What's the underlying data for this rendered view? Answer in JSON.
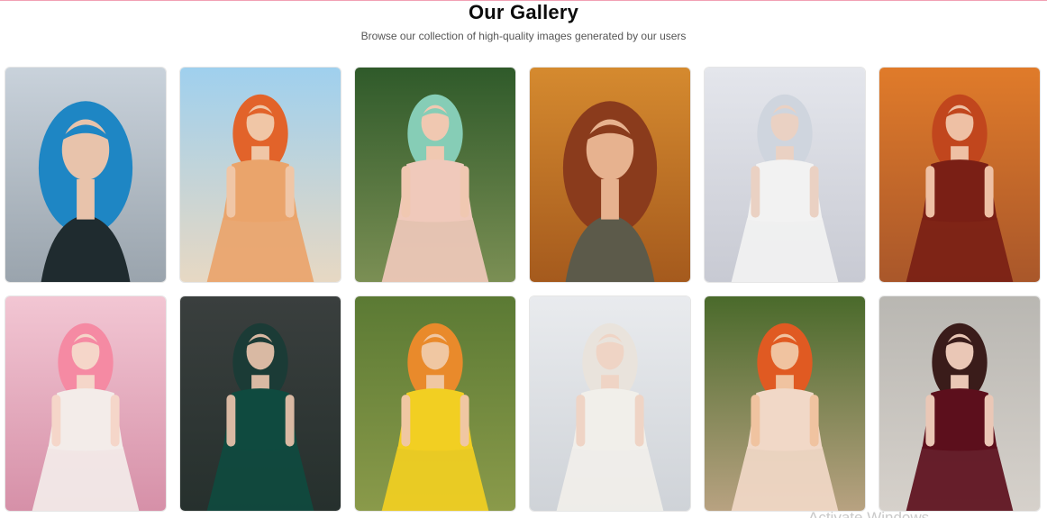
{
  "header": {
    "title": "Our Gallery",
    "subtitle": "Browse our collection of high-quality images generated by our users"
  },
  "gallery": {
    "images": [
      {
        "subject": "woman with long blue hair",
        "bg_top": "#c9d2db",
        "bg_bottom": "#9aa4ad",
        "hair": "#1e86c4",
        "skin": "#e8c3ab",
        "outfit": "#1f2b2f"
      },
      {
        "subject": "woman in floral romper on beach",
        "bg_top": "#9fd0ee",
        "bg_bottom": "#e7d8c3",
        "hair": "#e2632a",
        "skin": "#f0c6a6",
        "outfit": "#eaa46b"
      },
      {
        "subject": "woman with mint green hair in garden",
        "bg_top": "#2f5a2a",
        "bg_bottom": "#7b8f54",
        "hair": "#86cdb6",
        "skin": "#f0c8b1",
        "outfit": "#f0c9bb"
      },
      {
        "subject": "woman with auburn wavy hair in autumn",
        "bg_top": "#d58a2f",
        "bg_bottom": "#a55a1d",
        "hair": "#8a3b1c",
        "skin": "#e7b28f",
        "outfit": "#5c5a4a"
      },
      {
        "subject": "woman with silver hair and white shirt",
        "bg_top": "#e4e6ec",
        "bg_bottom": "#c8cad3",
        "hair": "#cfd5de",
        "skin": "#ead1c3",
        "outfit": "#f2f2f2"
      },
      {
        "subject": "woman in red sweater among autumn leaves",
        "bg_top": "#e07b2a",
        "bg_bottom": "#a9572a",
        "hair": "#c1461d",
        "skin": "#eec0a4",
        "outfit": "#7a1f15"
      },
      {
        "subject": "woman with pink hair and flowers",
        "bg_top": "#f2c6d3",
        "bg_bottom": "#d690a8",
        "hair": "#f58aa3",
        "skin": "#f5d6c9",
        "outfit": "#f3ece9"
      },
      {
        "subject": "woman in emerald gown in dark room",
        "bg_top": "#3a3f3e",
        "bg_bottom": "#26302d",
        "hair": "#1b3b36",
        "skin": "#d9b9a3",
        "outfit": "#0f4a3f"
      },
      {
        "subject": "woman in yellow sundress in garden",
        "bg_top": "#5b7a34",
        "bg_bottom": "#8a9a4a",
        "hair": "#e98a2b",
        "skin": "#f0c7a2",
        "outfit": "#f2cf22"
      },
      {
        "subject": "woman in white suit with platinum bob",
        "bg_top": "#e9ebee",
        "bg_bottom": "#cfd3d8",
        "hair": "#e9e3dc",
        "skin": "#efd4c5",
        "outfit": "#f1efea"
      },
      {
        "subject": "woman in floral dress on garden path",
        "bg_top": "#4a6a2b",
        "bg_bottom": "#b8a281",
        "hair": "#e05a22",
        "skin": "#f0c3a0",
        "outfit": "#f1d8c7"
      },
      {
        "subject": "woman in burgundy velvet gown",
        "bg_top": "#b9b7b2",
        "bg_bottom": "#d6d1cb",
        "hair": "#3a1c1a",
        "skin": "#eac7b6",
        "outfit": "#5c0f1c"
      }
    ]
  },
  "system": {
    "watermark": "Activate Windows"
  }
}
